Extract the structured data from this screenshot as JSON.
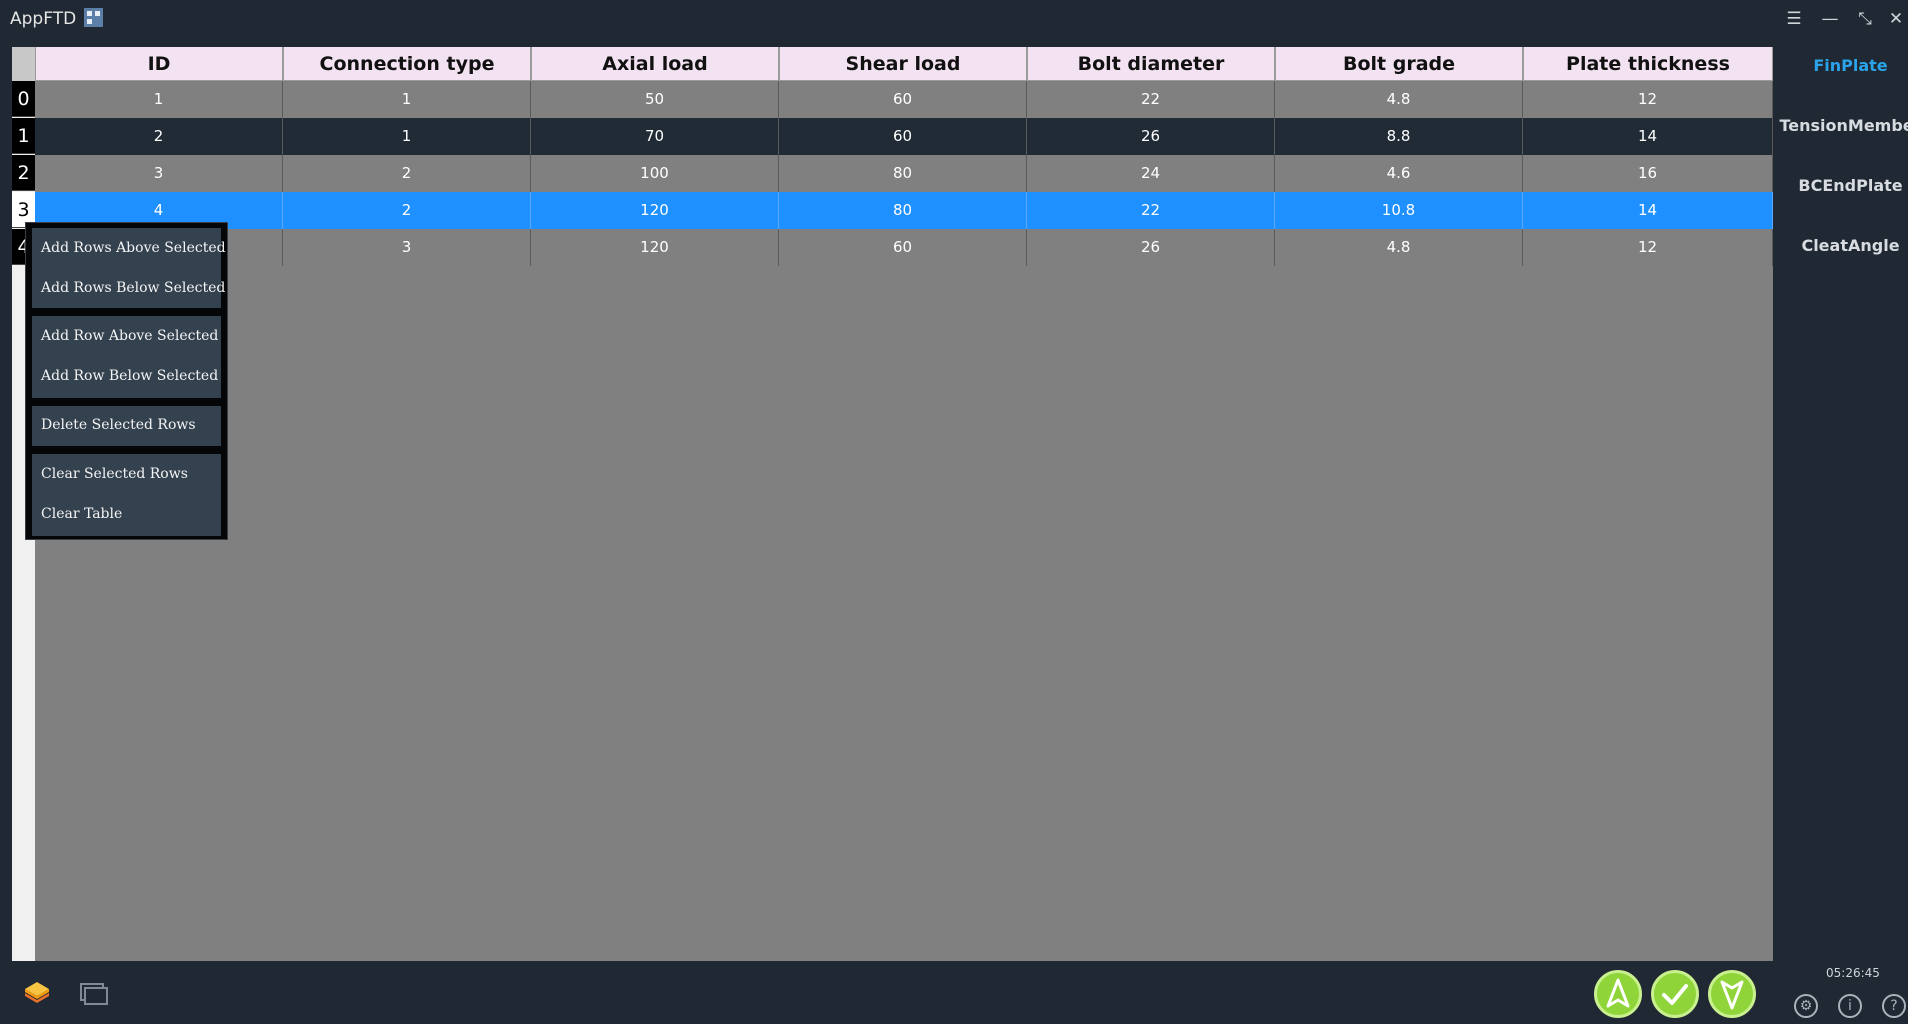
{
  "app": {
    "title": "AppFTD"
  },
  "window_controls": {
    "menu": "☰",
    "minimize": "—",
    "restore": "⤡",
    "close": "✕"
  },
  "table": {
    "columns": [
      "ID",
      "Connection type",
      "Axial load",
      "Shear load",
      "Bolt diameter",
      "Bolt grade",
      "Plate thickness"
    ],
    "row_headers": [
      "0",
      "1",
      "2",
      "3",
      "4"
    ],
    "rows": [
      [
        "1",
        "1",
        "50",
        "60",
        "22",
        "4.8",
        "12"
      ],
      [
        "2",
        "1",
        "70",
        "60",
        "26",
        "8.8",
        "14"
      ],
      [
        "3",
        "2",
        "100",
        "80",
        "24",
        "4.6",
        "16"
      ],
      [
        "4",
        "2",
        "120",
        "80",
        "22",
        "10.8",
        "14"
      ],
      [
        "",
        "3",
        "120",
        "60",
        "26",
        "4.8",
        "12"
      ]
    ],
    "selected_row": 3
  },
  "context_menu": {
    "items": [
      "Add Rows Above Selected",
      "Add Rows Below Selected",
      "Add Row Above Selected",
      "Add Row Below Selected",
      "Delete Selected Rows",
      "Clear Selected Rows",
      "Clear Table"
    ]
  },
  "modules": {
    "tabs": [
      "FinPlate",
      "TensionMember",
      "BCEndPlate",
      "CleatAngle"
    ],
    "active": "FinPlate"
  },
  "status": {
    "time": "05:26:45"
  },
  "bottom_left_icons": [
    "layers-icon",
    "windows-icon"
  ],
  "bottom_right_icons": [
    "settings-icon",
    "info-icon",
    "help-icon"
  ],
  "action_buttons": [
    "up-arrow-icon",
    "check-icon",
    "down-arrow-icon"
  ],
  "colors": {
    "background": "#1f2833",
    "table_gray": "#808080",
    "row_dark": "#212b36",
    "selected_row": "#1e90ff",
    "header_bg": "#f3e2f1",
    "active_module": "#2aa3e8",
    "action_green": "#8fd53a"
  }
}
